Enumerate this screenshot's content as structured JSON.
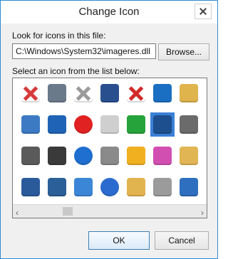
{
  "window": {
    "title": "Change Icon"
  },
  "labels": {
    "look_for": "Look for icons in this file:",
    "select_icon": "Select an icon from the list below:"
  },
  "path": {
    "value": "C:\\Windows\\System32\\imageres.dll"
  },
  "buttons": {
    "browse": "Browse...",
    "ok": "OK",
    "cancel": "Cancel"
  },
  "scrollbar": {
    "left_arrow": "‹",
    "right_arrow": "›"
  },
  "icons": [
    {
      "name": "red-x-icon",
      "color": "#d63b3b"
    },
    {
      "name": "mobile-device-icon",
      "color": "#6a7a8a"
    },
    {
      "name": "gray-x-icon",
      "color": "#9a9a9a"
    },
    {
      "name": "monitor-icon",
      "color": "#2a4f8f"
    },
    {
      "name": "shield-x-icon",
      "color": "#d22a2a"
    },
    {
      "name": "network-computer-icon",
      "color": "#1b6fc2"
    },
    {
      "name": "folder-icon",
      "color": "#e0b44c"
    },
    {
      "name": "document-icon",
      "color": "#3d7ac4"
    },
    {
      "name": "network-cable-icon",
      "color": "#1f63b7"
    },
    {
      "name": "error-circle-icon",
      "color": "#e12222"
    },
    {
      "name": "text-file-icon",
      "color": "#cfcfcf"
    },
    {
      "name": "shield-check-icon",
      "color": "#26a33b"
    },
    {
      "name": "window-icon",
      "color": "#1d4f8e"
    },
    {
      "name": "settings-icon",
      "color": "#6b6b6b"
    },
    {
      "name": "printer-icon",
      "color": "#5a5a5a"
    },
    {
      "name": "scanner-icon",
      "color": "#3a3a3a"
    },
    {
      "name": "help-icon",
      "color": "#1e6fd0"
    },
    {
      "name": "projector-screen-icon",
      "color": "#8a8a8a"
    },
    {
      "name": "shield-warning-icon",
      "color": "#f0b020"
    },
    {
      "name": "apps-icon",
      "color": "#d24fb2"
    },
    {
      "name": "star-folder-icon",
      "color": "#e1b553"
    },
    {
      "name": "monitor-stand-icon",
      "color": "#2a5a9a"
    },
    {
      "name": "tablet-icon",
      "color": "#2b5f97"
    },
    {
      "name": "frame-icon",
      "color": "#3b86d6"
    },
    {
      "name": "shield-help-icon",
      "color": "#2b6bd0"
    },
    {
      "name": "music-folder-icon",
      "color": "#e2b44f"
    },
    {
      "name": "notepad-icon",
      "color": "#9b9b9b"
    },
    {
      "name": "list-icon",
      "color": "#2f6fbf"
    }
  ]
}
